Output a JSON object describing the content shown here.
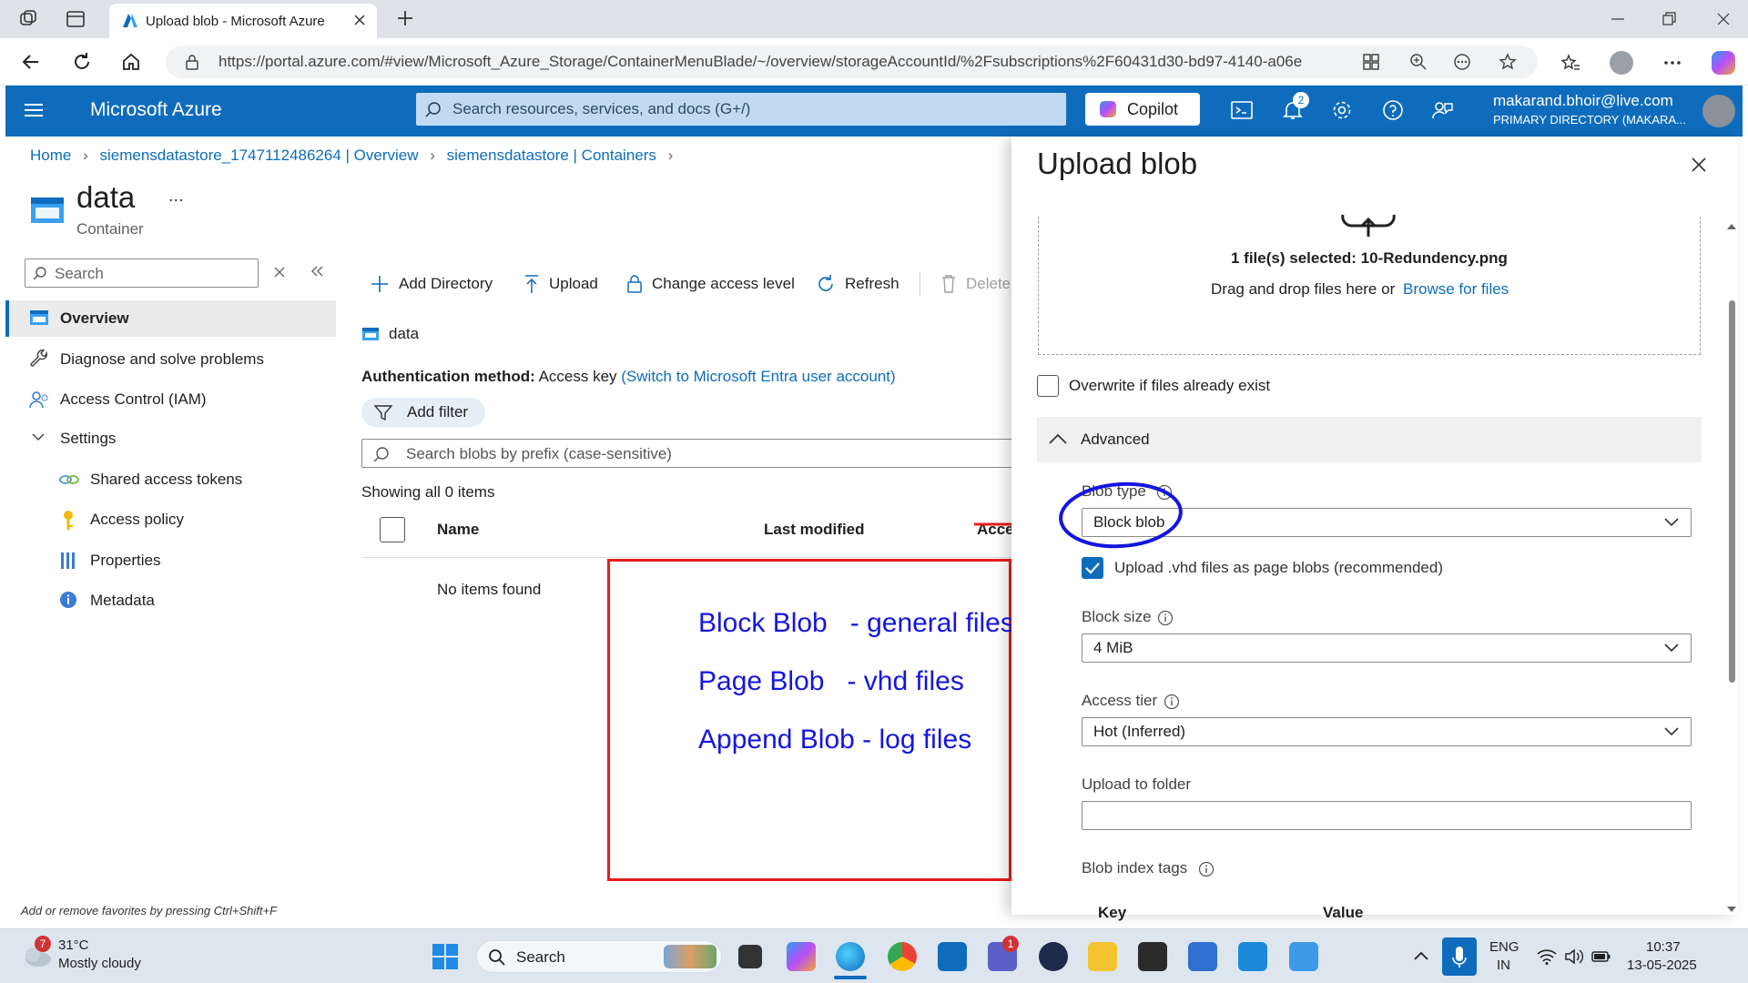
{
  "browser": {
    "tab_title": "Upload blob - Microsoft Azure",
    "url": "https://portal.azure.com/#view/Microsoft_Azure_Storage/ContainerMenuBlade/~/overview/storageAccountId/%2Fsubscriptions%2F60431d30-bd97-4140-a06e..."
  },
  "azure": {
    "brand": "Microsoft Azure",
    "search_placeholder": "Search resources, services, and docs (G+/)",
    "copilot_label": "Copilot",
    "notification_count": "2",
    "user_email": "makarand.bhoir@live.com",
    "user_directory": "PRIMARY DIRECTORY (MAKARA..."
  },
  "breadcrumb": {
    "home": "Home",
    "item1": "siemensdatastore_1747112486264 | Overview",
    "item2": "siemensdatastore | Containers"
  },
  "resource": {
    "title": "data",
    "subtitle": "Container",
    "more": "..."
  },
  "leftnav": {
    "search_placeholder": "Search",
    "items": [
      {
        "label": "Overview"
      },
      {
        "label": "Diagnose and solve problems"
      },
      {
        "label": "Access Control (IAM)"
      },
      {
        "label": "Settings"
      },
      {
        "label": "Shared access tokens"
      },
      {
        "label": "Access policy"
      },
      {
        "label": "Properties"
      },
      {
        "label": "Metadata"
      }
    ],
    "favorites_hint": "Add or remove favorites by pressing Ctrl+Shift+F"
  },
  "toolbar": {
    "add_directory": "Add Directory",
    "upload": "Upload",
    "change_access": "Change access level",
    "refresh": "Refresh",
    "delete": "Delete"
  },
  "content": {
    "folder": "data",
    "auth_label": "Authentication method:",
    "auth_value": "Access key",
    "auth_switch": "(Switch to Microsoft Entra user account)",
    "add_filter": "Add filter",
    "search_blobs_placeholder": "Search blobs by prefix (case-sensitive)",
    "showing": "Showing all 0 items",
    "col_name": "Name",
    "col_modified": "Last modified",
    "col_access": "Acce",
    "empty": "No items found"
  },
  "annotation": {
    "line1": "Block Blob   - general files",
    "line2": "Page Blob   - vhd files",
    "line3": "Append Blob - log files"
  },
  "panel": {
    "title": "Upload blob",
    "files_selected": "1 file(s) selected: 10-Redundency.png",
    "drag_drop": "Drag and drop files here",
    "or": "or",
    "browse": "Browse for files",
    "overwrite": "Overwrite if files already exist",
    "advanced": "Advanced",
    "blob_type_label": "Blob type",
    "blob_type_value": "Block blob",
    "upload_vhd": "Upload .vhd files as page blobs (recommended)",
    "block_size_label": "Block size",
    "block_size_value": "4 MiB",
    "access_tier_label": "Access tier",
    "access_tier_value": "Hot (Inferred)",
    "upload_folder_label": "Upload to folder",
    "upload_folder_value": "",
    "index_tags_label": "Blob index tags",
    "key_col": "Key",
    "value_col": "Value"
  },
  "taskbar": {
    "weather_badge": "7",
    "temperature": "31°C",
    "weather": "Mostly cloudy",
    "search": "Search",
    "teams_badge": "1",
    "lang1": "ENG",
    "lang2": "IN",
    "time": "10:37",
    "date": "13-05-2025"
  }
}
